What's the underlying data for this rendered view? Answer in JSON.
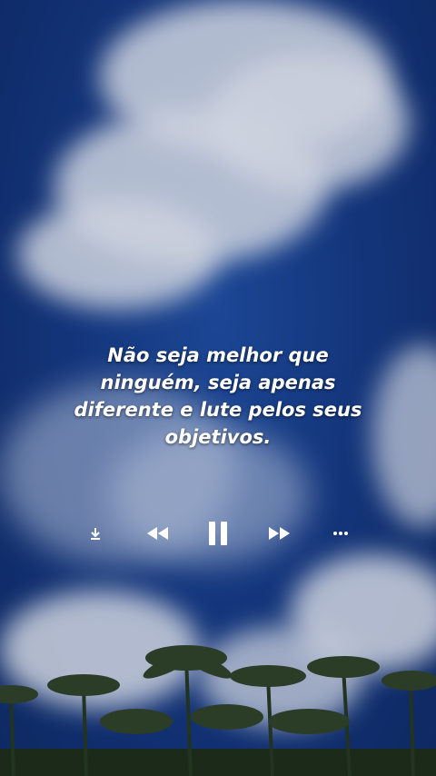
{
  "quote": {
    "lines": [
      "Não seja melhor que",
      "ninguém, seja apenas",
      "diferente e lute pelos seus",
      "objetivos."
    ]
  },
  "controls": {
    "download": {
      "icon": "download-icon"
    },
    "rewind": {
      "icon": "rewind-icon"
    },
    "pause": {
      "icon": "pause-icon"
    },
    "forward": {
      "icon": "fast-forward-icon"
    },
    "more": {
      "icon": "more-horizontal-icon"
    }
  },
  "colors": {
    "sky": "#163b86",
    "cloud": "#e9eef7",
    "text": "#ffffff"
  }
}
